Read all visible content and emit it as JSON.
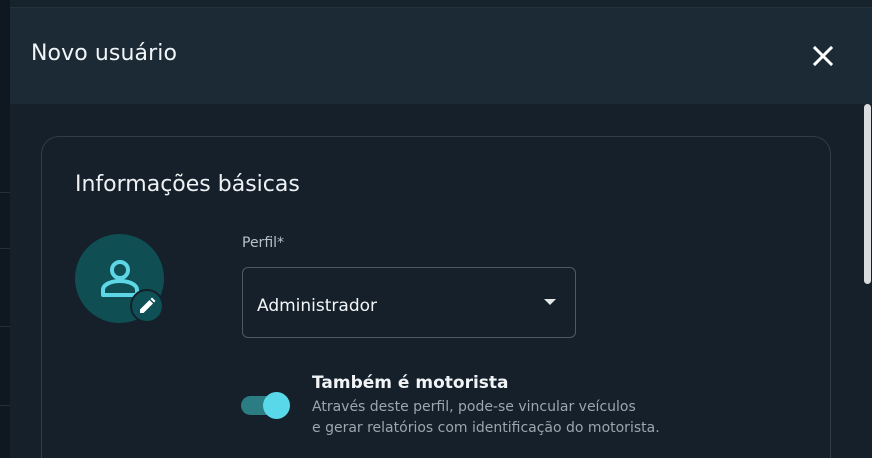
{
  "dialog": {
    "title": "Novo usuário",
    "close_icon": "close-icon"
  },
  "basic_info": {
    "section_title": "Informações básicas",
    "avatar_icon": "person-icon",
    "avatar_edit_icon": "pencil-icon",
    "profile": {
      "label": "Perfil*",
      "value": "Administrador",
      "caret_icon": "caret-down-icon"
    },
    "driver_toggle": {
      "title": "Também é motorista",
      "description_line1": "Através deste perfil, pode-se vincular veículos",
      "description_line2": "e gerar relatórios com identificação do motorista.",
      "on": true
    }
  },
  "colors": {
    "accent": "#58d8e8",
    "avatar_bg": "#0f4e53",
    "header_bg": "#1b2a35",
    "body_bg": "#15202a"
  }
}
